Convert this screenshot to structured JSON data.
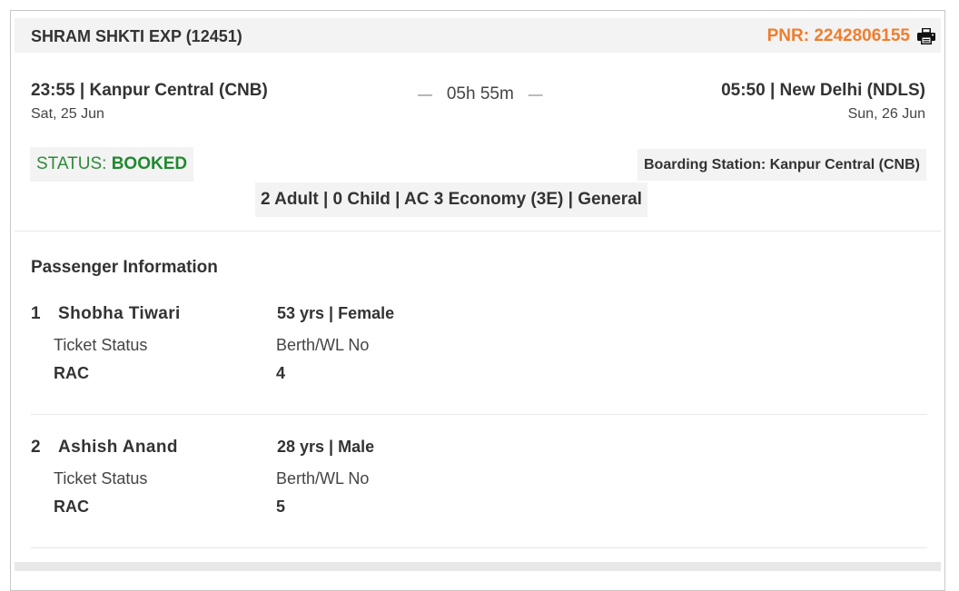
{
  "header": {
    "train_name": "SHRAM SHKTI EXP (12451)",
    "pnr": "PNR: 2242806155",
    "print_icon": "printer-icon",
    "pnr_color": "#f07d2c"
  },
  "journey": {
    "departure": {
      "time_station": "23:55 | Kanpur Central (CNB)",
      "date": "Sat, 25 Jun"
    },
    "duration": "05h 55m",
    "duration_dash": "—",
    "arrival": {
      "time_station": "05:50 | New Delhi (NDLS)",
      "date": "Sun, 26 Jun"
    }
  },
  "status": {
    "label": "STATUS: ",
    "value": "BOOKED",
    "color": "#1f8a2e"
  },
  "boarding": "Boarding Station: Kanpur Central (CNB)",
  "booking_class": "2 Adult | 0 Child | AC 3 Economy (3E) | General",
  "passenger_section": {
    "title": "Passenger Information",
    "ticket_status_label": "Ticket Status",
    "berth_label": "Berth/WL No",
    "passengers": [
      {
        "num": "1",
        "name": "Shobha Tiwari",
        "age_gender": "53 yrs | Female",
        "ticket_status": "RAC",
        "berth": "4"
      },
      {
        "num": "2",
        "name": "Ashish Anand",
        "age_gender": "28 yrs | Male",
        "ticket_status": "RAC",
        "berth": "5"
      }
    ]
  }
}
